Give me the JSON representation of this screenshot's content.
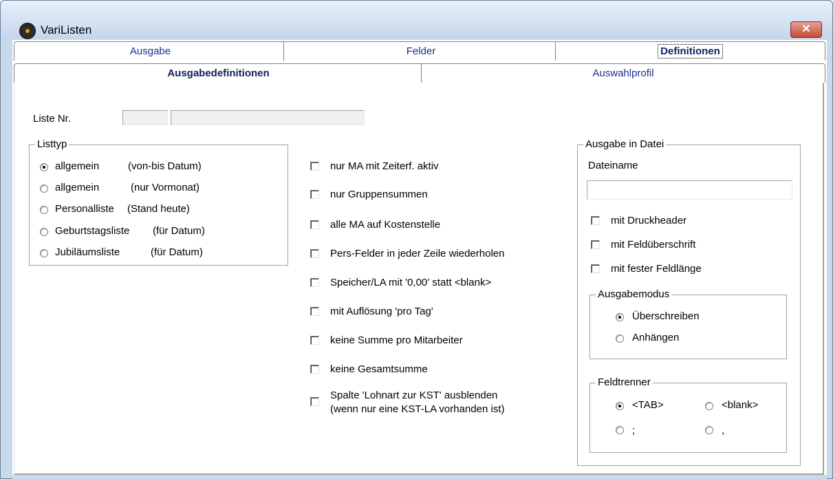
{
  "window": {
    "title": "VariListen",
    "close_glyph": "✕"
  },
  "tabs_top": [
    "Ausgabe",
    "Felder",
    "Definitionen"
  ],
  "tabs_second": [
    "Ausgabedefinitionen",
    "Auswahlprofil"
  ],
  "liste": {
    "label": "Liste Nr.",
    "number": "",
    "name": ""
  },
  "listtyp": {
    "title": "Listtyp",
    "options": [
      {
        "name": "allgemein",
        "hint": "(von-bis Datum)",
        "selected": true
      },
      {
        "name": "allgemein",
        "hint": "(nur Vormonat)",
        "selected": false
      },
      {
        "name": "Personalliste",
        "hint": "(Stand heute)",
        "selected": false
      },
      {
        "name": "Geburtstagsliste",
        "hint": "(für Datum)",
        "selected": false
      },
      {
        "name": "Jubiläumsliste",
        "hint": "(für Datum)",
        "selected": false
      }
    ]
  },
  "options": [
    "nur MA mit Zeiterf. aktiv",
    "nur Gruppensummen",
    "alle MA auf Kostenstelle",
    "Pers-Felder in jeder Zeile wiederholen",
    "Speicher/LA mit '0,00' statt <blank>",
    "mit Auflösung 'pro Tag'",
    "keine Summe pro Mitarbeiter",
    "keine Gesamtsumme",
    "Spalte 'Lohnart zur KST' ausblenden",
    "(wenn nur eine KST-LA vorhanden ist)"
  ],
  "ausgabe_datei": {
    "title": "Ausgabe in Datei",
    "dateiname_label": "Dateiname",
    "dateiname_value": "",
    "checks": [
      "mit Druckheader",
      "mit Feldüberschrift",
      "mit fester Feldlänge"
    ],
    "modus": {
      "title": "Ausgabemodus",
      "options": [
        "Überschreiben",
        "Anhängen"
      ],
      "selected": 0
    },
    "trenner": {
      "title": "Feldtrenner",
      "options": [
        "<TAB>",
        "<blank>",
        ";",
        ","
      ],
      "selected": 0
    }
  }
}
